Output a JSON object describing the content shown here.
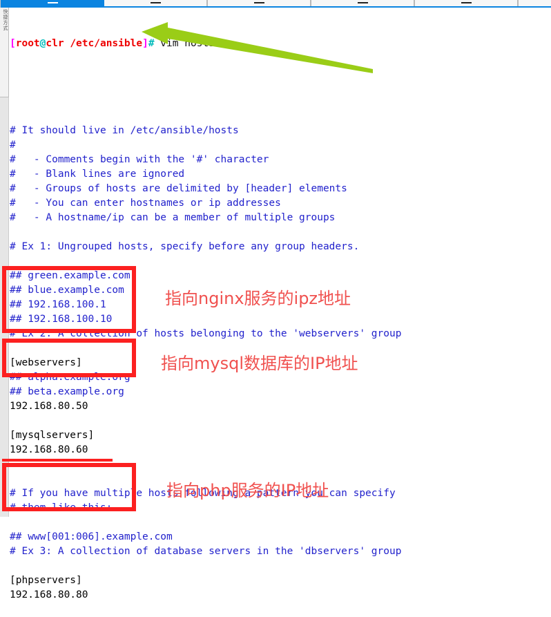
{
  "window": {
    "tabbar": {
      "tabs": [
        {
          "name": "tab-1",
          "glyph": "—",
          "active": true
        },
        {
          "name": "tab-2",
          "glyph": "—",
          "active": false
        },
        {
          "name": "tab-3",
          "glyph": "—",
          "active": false
        },
        {
          "name": "tab-4",
          "glyph": "—",
          "active": false
        },
        {
          "name": "tab-5",
          "glyph": "—",
          "active": false
        },
        {
          "name": "tab-6",
          "glyph": "—",
          "active": false
        }
      ],
      "accent_color": "#0b84e0"
    },
    "sidepanel": {
      "label": "快捷方式"
    }
  },
  "terminal": {
    "prompt": {
      "open_bracket": "[",
      "user": "root",
      "at": "@",
      "host": "clr",
      "space": " ",
      "path": "/etc/ansible",
      "close_bracket": "]",
      "hash": "#",
      "command": " vim hosts"
    },
    "lines": [
      {
        "text": "# It should live in /etc/ansible/hosts",
        "style": "comment"
      },
      {
        "text": "#",
        "style": "comment"
      },
      {
        "text": "#   - Comments begin with the '#' character",
        "style": "comment"
      },
      {
        "text": "#   - Blank lines are ignored",
        "style": "comment"
      },
      {
        "text": "#   - Groups of hosts are delimited by [header] elements",
        "style": "comment"
      },
      {
        "text": "#   - You can enter hostnames or ip addresses",
        "style": "comment"
      },
      {
        "text": "#   - A hostname/ip can be a member of multiple groups",
        "style": "comment"
      },
      {
        "text": "",
        "style": "comment"
      },
      {
        "text": "# Ex 1: Ungrouped hosts, specify before any group headers.",
        "style": "comment"
      },
      {
        "text": "",
        "style": "comment"
      },
      {
        "text": "## green.example.com",
        "style": "comment"
      },
      {
        "text": "## blue.example.com",
        "style": "comment"
      },
      {
        "text": "## 192.168.100.1",
        "style": "comment"
      },
      {
        "text": "## 192.168.100.10",
        "style": "comment"
      },
      {
        "text": "# Ex 2: A collection of hosts belonging to the 'webservers' group",
        "style": "comment"
      },
      {
        "text": "",
        "style": "comment"
      },
      {
        "text": "[webservers]",
        "style": "plain"
      },
      {
        "text": "## alpha.example.org",
        "style": "comment"
      },
      {
        "text": "## beta.example.org",
        "style": "comment"
      },
      {
        "text": "192.168.80.50",
        "style": "plain"
      },
      {
        "text": "",
        "style": "comment"
      },
      {
        "text": "[mysqlservers]",
        "style": "plain"
      },
      {
        "text": "192.168.80.60",
        "style": "plain"
      },
      {
        "text": "",
        "style": "comment"
      },
      {
        "text": "",
        "style": "comment"
      },
      {
        "text": "# If you have multiple hosts following a pattern you can specify",
        "style": "comment"
      },
      {
        "text": "# them like this:",
        "style": "comment"
      },
      {
        "text": "",
        "style": "comment"
      },
      {
        "text": "## www[001:006].example.com",
        "style": "comment"
      },
      {
        "text": "# Ex 3: A collection of database servers in the 'dbservers' group",
        "style": "comment"
      },
      {
        "text": "",
        "style": "comment"
      },
      {
        "text": "[phpservers]",
        "style": "plain"
      },
      {
        "text": "192.168.80.80",
        "style": "plain"
      }
    ]
  },
  "annotations": {
    "box_color": "#fc2020",
    "note_color": "#f0514f",
    "arrow_color": "#9acd17",
    "notes": [
      {
        "name": "nginx-note",
        "text": "指向nginx服务的ipz地址"
      },
      {
        "name": "mysql-note",
        "text": "指向mysql数据库的IP地址"
      },
      {
        "name": "php-note",
        "text": "指向php服务的IP地址"
      }
    ]
  }
}
